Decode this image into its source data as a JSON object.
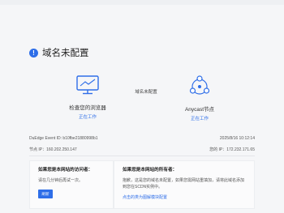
{
  "page": {
    "title": "域名未配置",
    "info_icon_glyph": "!"
  },
  "flow": {
    "browser": {
      "label": "检查您的浏览器",
      "status": "正在工作"
    },
    "middle": "域名未配置",
    "anycast": {
      "label": "Anycast节点",
      "status": "正在工作"
    }
  },
  "meta": {
    "event_id": "DuEdge Event ID: b10fbe21880998b1",
    "datetime": "2025/8/16 10:12:14",
    "node_ip": "节点 IP：160.202.250.147",
    "your_ip": "您的 IP：172.232.171.65"
  },
  "visitor_panel": {
    "heading": "如果您是本网站的访问者：",
    "body": "请在几分钟后再试一次。",
    "button": "刷新"
  },
  "owner_panel": {
    "heading": "如果您是本网站的所有者：",
    "body": "抱歉，这是您的域名未配置，如果您需网站重填加，请将此域名添加到您在SCDN实例中。",
    "link": "点击的类为图解模块配置"
  },
  "colors": {
    "accent": "#2e6ee8"
  }
}
